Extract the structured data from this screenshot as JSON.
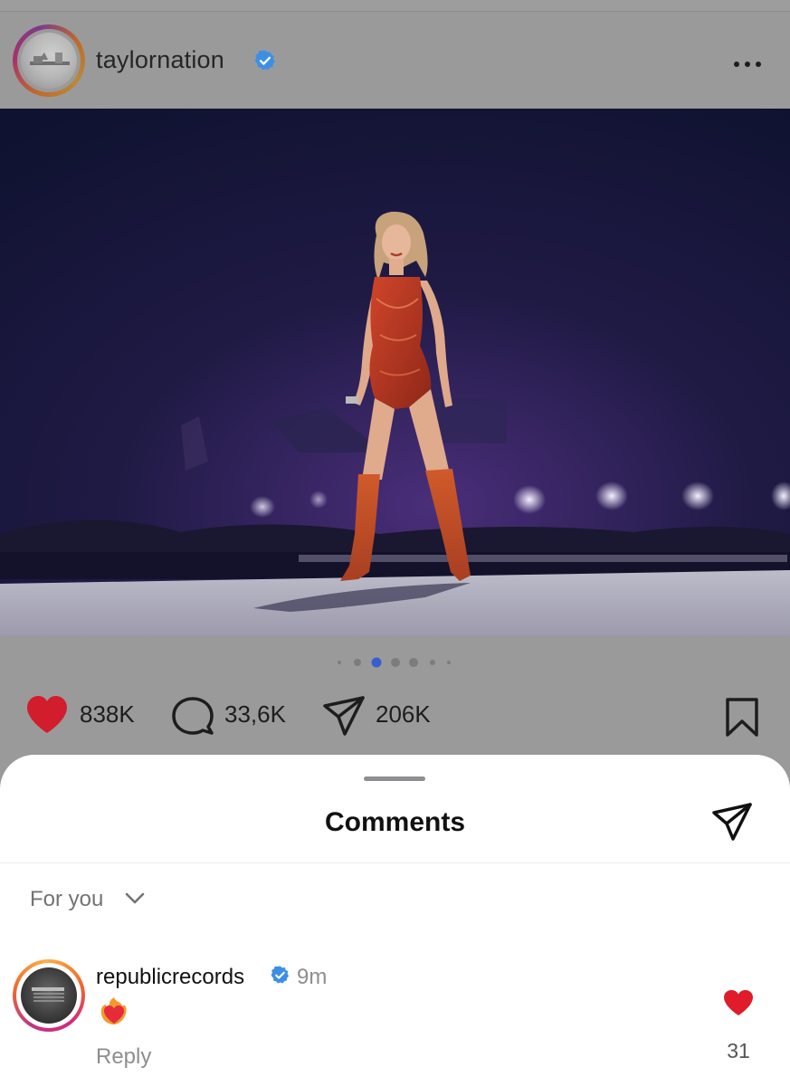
{
  "post": {
    "username": "taylornation",
    "verified": true,
    "more_icon": "more-horizontal-icon",
    "image_alt": "performer on stage in red sparkly bodysuit and orange boots",
    "carousel": {
      "count": 7,
      "active_index": 2
    },
    "actions": {
      "likes": "838K",
      "comments": "33,6K",
      "shares": "206K"
    },
    "colors": {
      "like_heart": "#d21d2d",
      "verified_badge": "#3d8fe6"
    }
  },
  "comments_sheet": {
    "title": "Comments",
    "filter_label": "For you",
    "send_icon": "send-icon",
    "comment": {
      "username": "republicrecords",
      "verified": true,
      "time": "9m",
      "text_emoji": "❤️‍🔥",
      "reply_label": "Reply",
      "likes": "31"
    }
  }
}
